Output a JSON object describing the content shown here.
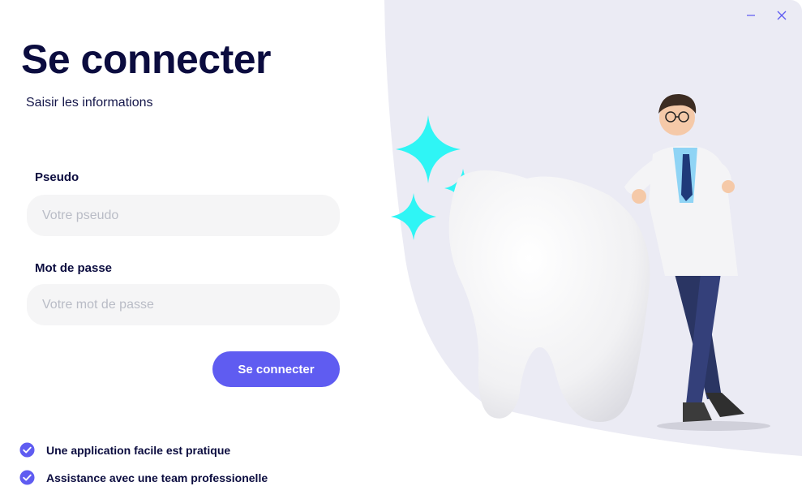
{
  "login": {
    "title": "Se connecter",
    "subtitle": "Saisir les informations",
    "username_label": "Pseudo",
    "username_placeholder": "Votre pseudo",
    "password_label": "Mot de passe",
    "password_placeholder": "Votre mot de passe",
    "submit_label": "Se connecter"
  },
  "features": [
    "Une application facile est pratique",
    "Assistance avec une team professionelle"
  ],
  "window_controls": {
    "minimize_icon": "minimize-icon",
    "close_icon": "close-icon"
  },
  "colors": {
    "accent": "#5f5cf1",
    "title": "#0b0c3f",
    "panel": "#ebebf4",
    "sparkle": "#2ff5f5"
  }
}
